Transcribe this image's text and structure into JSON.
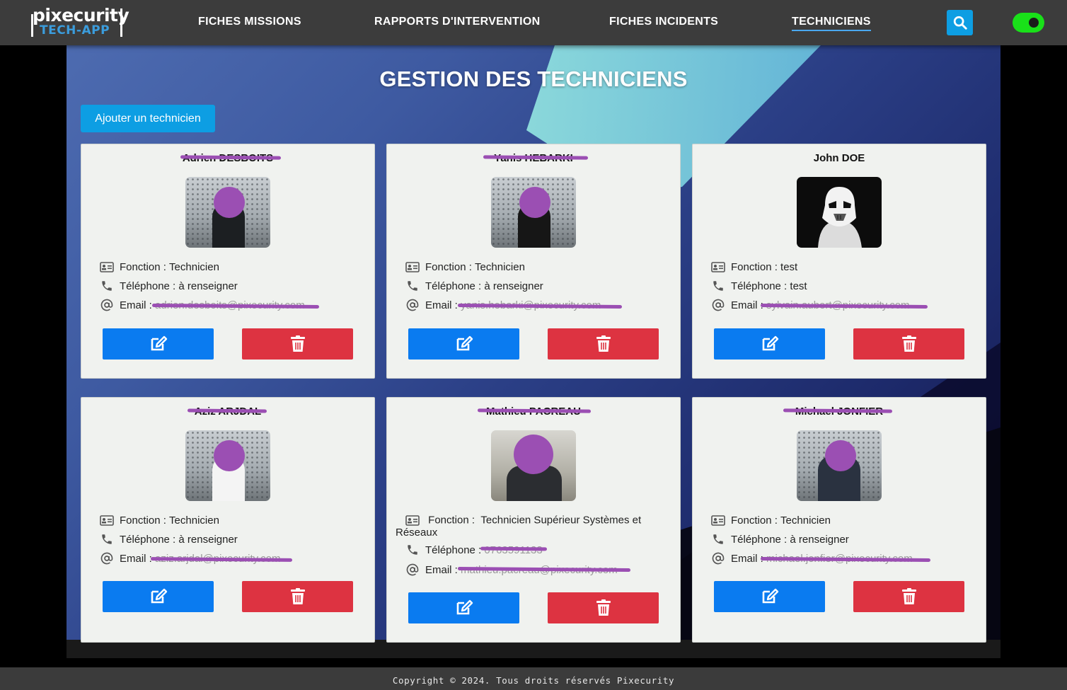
{
  "app": {
    "logo_line1": "pixecurity",
    "logo_line2": "TECH-APP"
  },
  "nav": {
    "items": [
      {
        "label": "FICHES MISSIONS",
        "active": false
      },
      {
        "label": "RAPPORTS D'INTERVENTION",
        "active": false
      },
      {
        "label": "FICHES INCIDENTS",
        "active": false
      },
      {
        "label": "TECHNICIENS",
        "active": true
      }
    ],
    "search_icon": "search-icon",
    "theme_toggle_on": true,
    "toggle_color": "#19e019"
  },
  "page": {
    "title": "GESTION DES TECHNICIENS",
    "add_button_label": "Ajouter un technicien"
  },
  "labels": {
    "fonction": "Fonction : ",
    "telephone": "Téléphone : ",
    "email": "Email : "
  },
  "technicians": [
    {
      "name": "Adrien DESBOITS",
      "fonction": "Technicien",
      "telephone": "à renseigner",
      "email": "adrien.desboits@pixecurity.com",
      "photo": "person-dots"
    },
    {
      "name": "Yanis HEBARKI",
      "fonction": "Technicien",
      "telephone": "à renseigner",
      "email": "yanis.hebarki@pixecurity.com",
      "photo": "person-dots"
    },
    {
      "name": "John DOE",
      "fonction": "test",
      "telephone": "test",
      "email": "sylvain.aubert@pixecurity.com",
      "photo": "stormtrooper"
    },
    {
      "name": "Aziz ARJDAL",
      "fonction": "Technicien",
      "telephone": "à renseigner",
      "email": "aziz.arjdal@pixecurity.com",
      "photo": "person-dots"
    },
    {
      "name": "Mathieu PACREAU",
      "fonction": "Technicien Supérieur Systèmes et Réseaux",
      "telephone": "0763591133",
      "email": "mathieu.pacreau@pixecurity.com",
      "photo": "person-office"
    },
    {
      "name": "Michael JONFIER",
      "fonction": "Technicien",
      "telephone": "à renseigner",
      "email": "michael.jonfier@pixecurity.com",
      "photo": "person-dots"
    }
  ],
  "colors": {
    "edit_button": "#0a7bf0",
    "delete_button": "#dd3341",
    "accent": "#0d9ee3",
    "redaction": "#9b4fb3"
  },
  "footer": {
    "text": "Copyright © 2024. Tous droits réservés Pixecurity"
  }
}
